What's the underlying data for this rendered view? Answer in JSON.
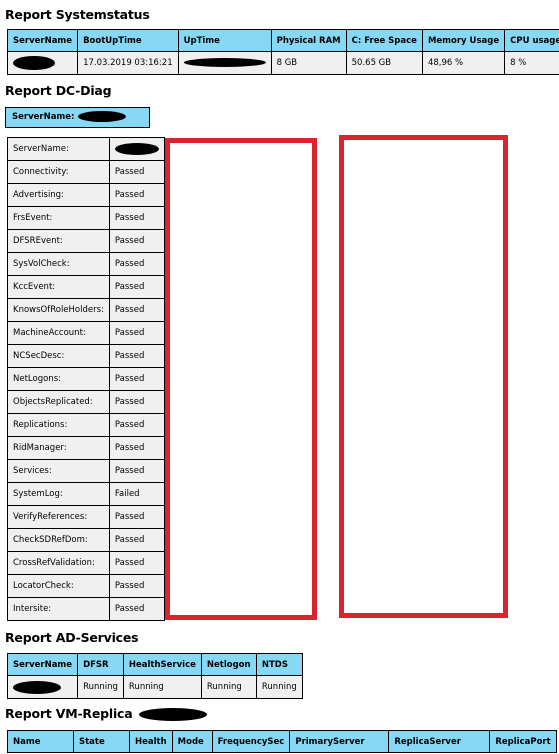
{
  "sections": {
    "systemstatus_title": "Report Systemstatus",
    "dcdiag_title": "Report DC-Diag",
    "adservices_title": "Report AD-Services",
    "vmreplica_title": "Report VM-Replica"
  },
  "systemstatus": {
    "headers": [
      "ServerName",
      "BootUpTime",
      "UpTime",
      "Physical RAM",
      "C: Free Space",
      "Memory Usage",
      "CPU usage"
    ],
    "row": {
      "servername": "",
      "bootuptime": "17.03.2019 03:16:21",
      "uptime": "",
      "physical_ram": "8 GB",
      "c_free_space": "50.65 GB",
      "memory_usage": "48,96 %",
      "cpu_usage": "8 %"
    }
  },
  "dcdiag": {
    "server_label": "ServerName:",
    "rows": [
      {
        "test": "ServerName:",
        "result": ""
      },
      {
        "test": "Connectivity:",
        "result": "Passed"
      },
      {
        "test": "Advertising:",
        "result": "Passed"
      },
      {
        "test": "FrsEvent:",
        "result": "Passed"
      },
      {
        "test": "DFSREvent:",
        "result": "Passed"
      },
      {
        "test": "SysVolCheck:",
        "result": "Passed"
      },
      {
        "test": "KccEvent:",
        "result": "Passed"
      },
      {
        "test": "KnowsOfRoleHolders:",
        "result": "Passed"
      },
      {
        "test": "MachineAccount:",
        "result": "Passed"
      },
      {
        "test": "NCSecDesc:",
        "result": "Passed"
      },
      {
        "test": "NetLogons:",
        "result": "Passed"
      },
      {
        "test": "ObjectsReplicated:",
        "result": "Passed"
      },
      {
        "test": "Replications:",
        "result": "Passed"
      },
      {
        "test": "RidManager:",
        "result": "Passed"
      },
      {
        "test": "Services:",
        "result": "Passed"
      },
      {
        "test": "SystemLog:",
        "result": "Failed"
      },
      {
        "test": "VerifyReferences:",
        "result": "Passed"
      },
      {
        "test": "CheckSDRefDom:",
        "result": "Passed"
      },
      {
        "test": "CrossRefValidation:",
        "result": "Passed"
      },
      {
        "test": "LocatorCheck:",
        "result": "Passed"
      },
      {
        "test": "Intersite:",
        "result": "Passed"
      }
    ]
  },
  "adservices": {
    "headers": [
      "ServerName",
      "DFSR",
      "HealthService",
      "Netlogon",
      "NTDS"
    ],
    "row": {
      "servername": "",
      "dfsr": "Running",
      "healthservice": "Running",
      "netlogon": "Running",
      "ntds": "Running"
    }
  },
  "vmreplica": {
    "headers": [
      "Name",
      "State",
      "Health",
      "Mode",
      "FrequencySec",
      "PrimaryServer",
      "ReplicaServer",
      "ReplicaPort"
    ]
  },
  "colors": {
    "header_bg": "#87d8f4",
    "cell_bg": "#f0f0f0",
    "annotation_red": "#d9262e"
  }
}
